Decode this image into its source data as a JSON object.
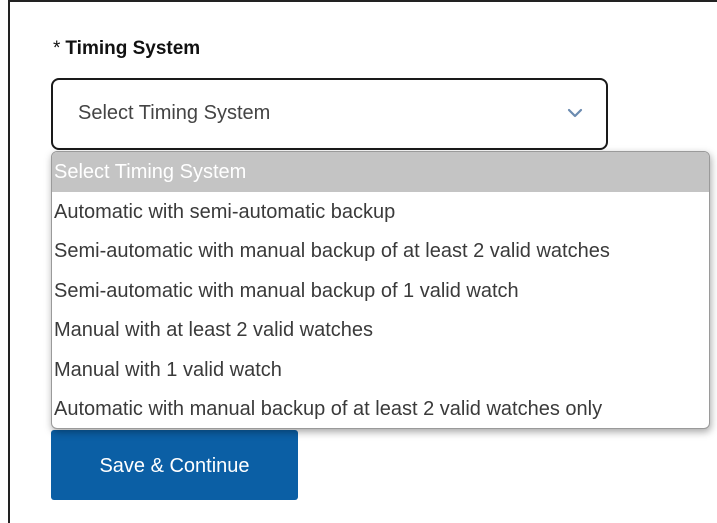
{
  "form": {
    "required_marker": "*",
    "timing_label": "Timing System",
    "select_value": "Select Timing System",
    "behind_char": ")"
  },
  "dropdown": {
    "options": [
      "Select Timing System",
      "Automatic with semi-automatic backup",
      "Semi-automatic with manual backup of at least 2 valid watches",
      "Semi-automatic with manual backup of 1 valid watch",
      "Manual with at least 2 valid watches",
      "Manual with 1 valid watch",
      "Automatic with manual backup of at least 2 valid watches only"
    ],
    "selected_index": 0
  },
  "actions": {
    "save_label": "Save & Continue"
  },
  "colors": {
    "primary": "#0b5fa5",
    "selected_option_bg": "#c4c4c4"
  },
  "icons": {
    "select_chevron": "chevron-down-icon"
  }
}
